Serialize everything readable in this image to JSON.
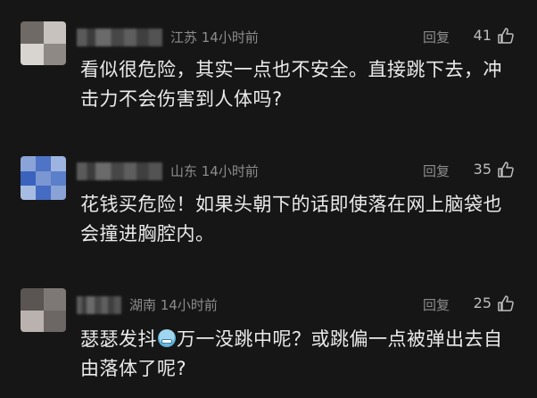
{
  "comments": [
    {
      "location_time": "江苏 14小时前",
      "reply_label": "回复",
      "likes": "41",
      "text": "看似很危险，其实一点也不安全。直接跳下去，冲击力不会伤害到人体吗?"
    },
    {
      "location_time": "山东 14小时前",
      "reply_label": "回复",
      "likes": "35",
      "text": "花钱买危险！如果头朝下的话即使落在网上脑袋也会撞进胸腔内。"
    },
    {
      "location_time": "湖南 14小时前",
      "reply_label": "回复",
      "likes": "25",
      "text_before_emoji": "瑟瑟发抖",
      "text_after_emoji": "万一没跳中呢？或跳偏一点被弹出去自由落体了呢?"
    }
  ],
  "icons": {
    "thumbs_up": "thumbs-up-icon",
    "emoji": "cold-face-emoji-icon"
  },
  "colors": {
    "background": "#161616",
    "meta_text": "#8c8c8c",
    "body_text": "#eaeaea"
  }
}
